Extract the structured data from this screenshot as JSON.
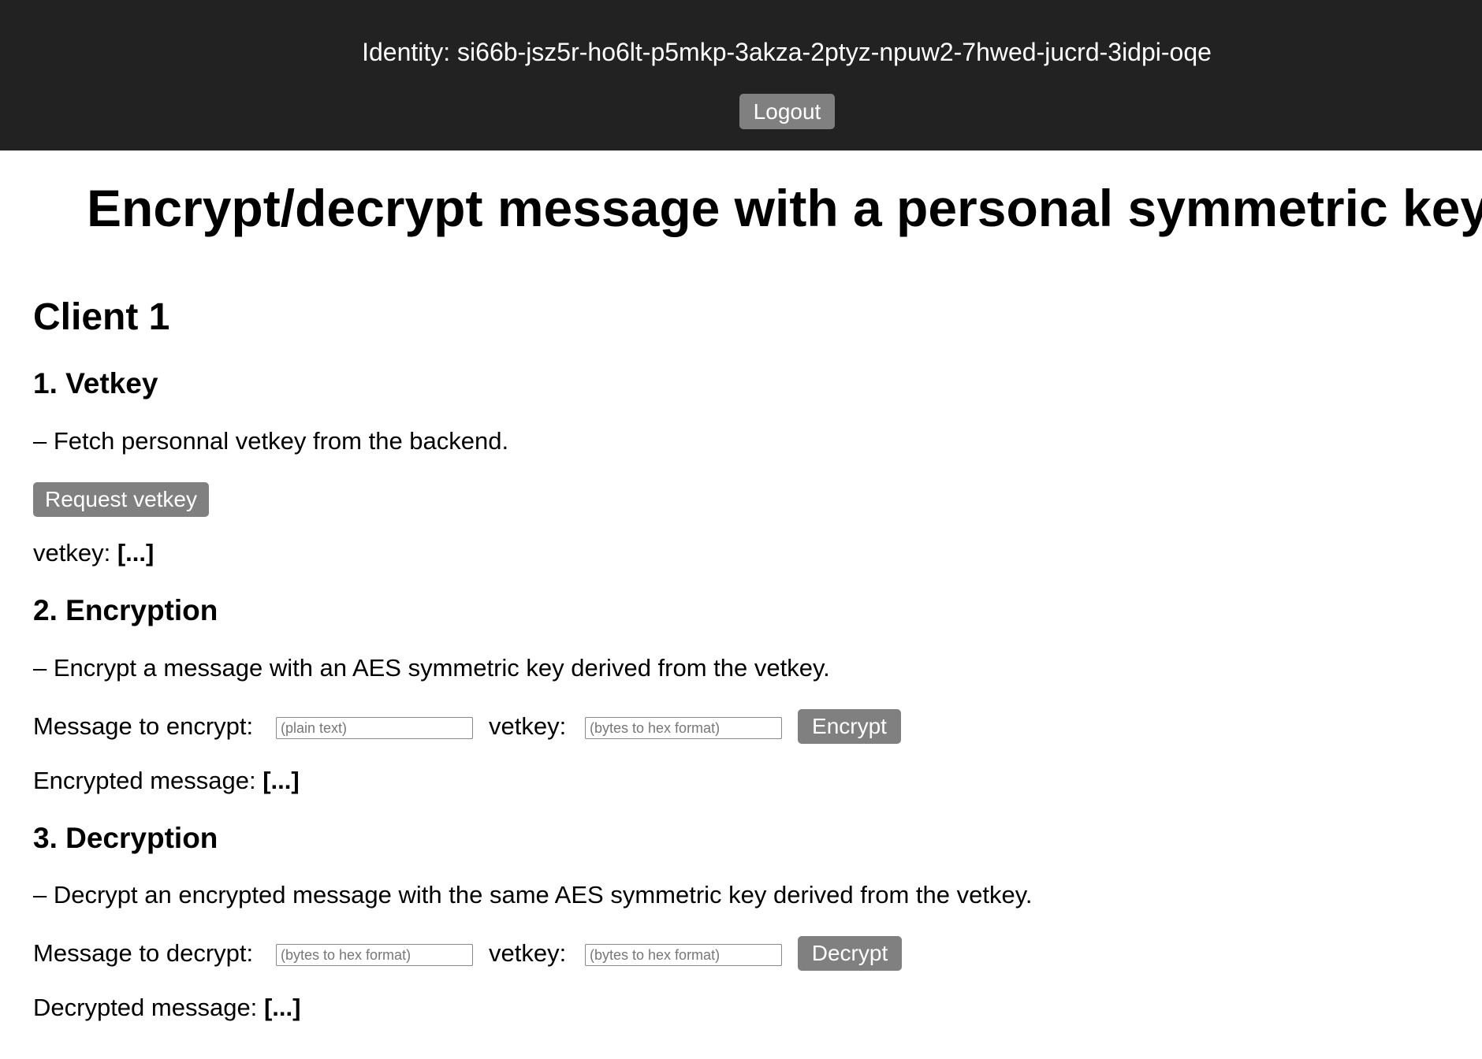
{
  "header": {
    "identity": "Identity: si66b-jsz5r-ho6lt-p5mkp-3akza-2ptyz-npuw2-7hwed-jucrd-3idpi-oqe",
    "logout_label": "Logout"
  },
  "title": "Encrypt/decrypt message with a personal symmetric key",
  "client_title": "Client 1",
  "vetkey_section": {
    "heading": "1. Vetkey",
    "description": "– Fetch personnal vetkey from the backend.",
    "button": "Request vetkey",
    "result_label": "vetkey:",
    "result_value": "[...]"
  },
  "encryption_section": {
    "heading": "2. Encryption",
    "description": "– Encrypt a message with an AES symmetric key derived from the vetkey.",
    "message_label": "Message to encrypt:",
    "message_placeholder": "(plain text)",
    "vetkey_label": "vetkey:",
    "vetkey_placeholder": "(bytes to hex format)",
    "button": "Encrypt",
    "result_label": "Encrypted message:",
    "result_value": "[...]"
  },
  "decryption_section": {
    "heading": "3. Decryption",
    "description": "– Decrypt an encrypted message with the same AES symmetric key derived from the vetkey.",
    "message_label": "Message to decrypt:",
    "message_placeholder": "(bytes to hex format)",
    "vetkey_label": "vetkey:",
    "vetkey_placeholder": "(bytes to hex format)",
    "button": "Decrypt",
    "result_label": "Decrypted message:",
    "result_value": "[...]"
  }
}
